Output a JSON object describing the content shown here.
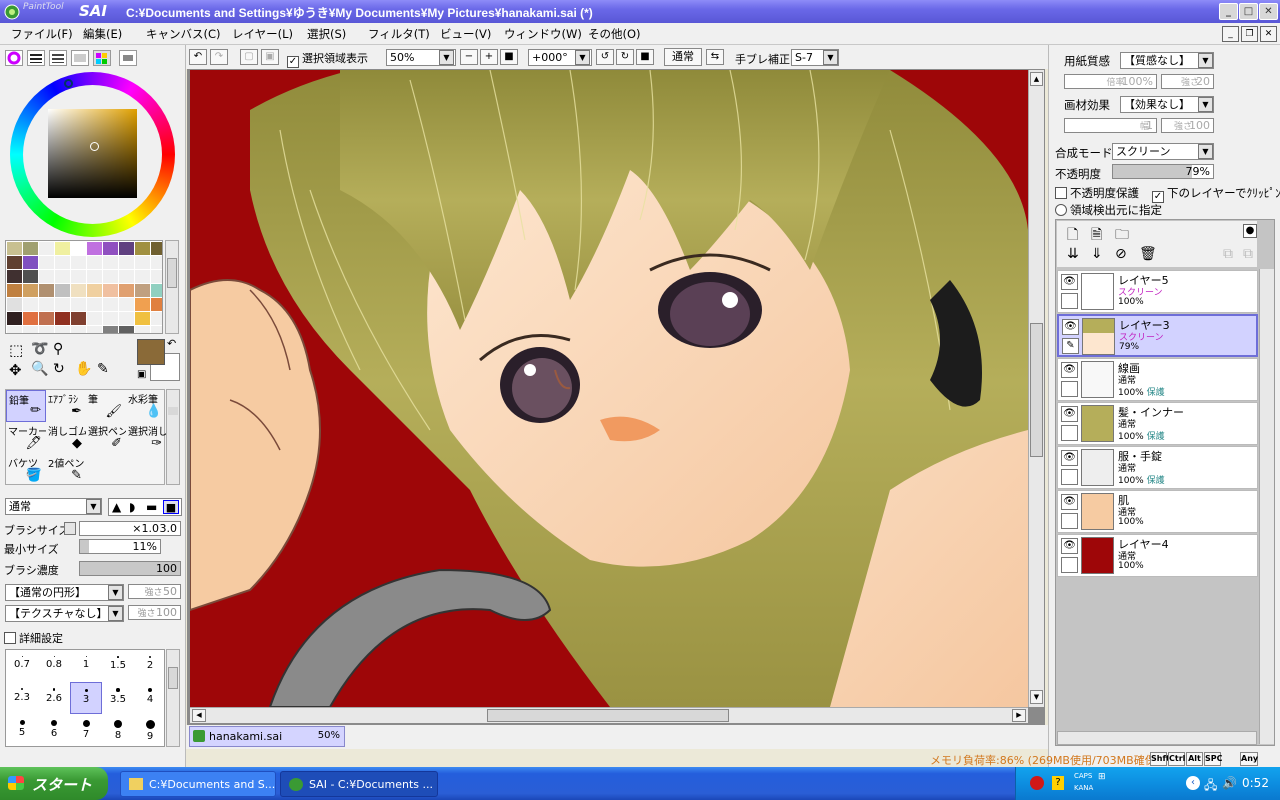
{
  "window": {
    "app_logo_top": "PaintTool",
    "app_logo_name": "SAI",
    "title": "C:¥Documents and Settings¥ゆうき¥My Documents¥My Pictures¥hanakami.sai (*)"
  },
  "menu": [
    "ファイル(F)",
    "編集(E)",
    "キャンバス(C)",
    "レイヤー(L)",
    "選択(S)",
    "フィルタ(T)",
    "ビュー(V)",
    "ウィンドウ(W)",
    "その他(O)"
  ],
  "canvas_toolbar": {
    "show_selection_label": "選択領域表示",
    "show_selection_checked": true,
    "zoom": "50%",
    "rotation": "+000°",
    "blend_button": "通常",
    "stabilizer_label": "手ブレ補正",
    "stabilizer_value": "S-7"
  },
  "left_panel": {
    "swatch_colors": [
      "#c8c090",
      "#a0a070",
      "#f0f0f0",
      "#f0f0a0",
      "#ffffff",
      "#c070e0",
      "#9050c0",
      "#604080",
      "#a09040",
      "#706030",
      "#604030",
      "#8050c0",
      "#f0f0f0",
      "#f0f0f0",
      "#f0f0f0",
      "#f0f0f0",
      "#f0f0f0",
      "#f0f0f0",
      "#f0f0f0",
      "#f0f0f0",
      "#403030",
      "#505050",
      "#f0f0f0",
      "#f0f0f0",
      "#f0f0f0",
      "#f0f0f0",
      "#f0f0f0",
      "#f0f0f0",
      "#f0f0f0",
      "#f0f0f0",
      "#c08040",
      "#d0a060",
      "#b09070",
      "#c0c0c0",
      "#f0e0c0",
      "#f0d0a0",
      "#f0c0a0",
      "#e0a070",
      "#c0a080",
      "#90d0c0",
      "#e0e0e0",
      "#f0f0f0",
      "#f0f0f0",
      "#f0f0f0",
      "#f0f0f0",
      "#f0f0f0",
      "#f0f0f0",
      "#f0f0f0",
      "#f0a050",
      "#e08040",
      "#302020",
      "#e07040",
      "#c07050",
      "#903020",
      "#804030",
      "#f0f0f0",
      "#f0f0f0",
      "#f0f0f0",
      "#f0c040",
      "#f0f0f0",
      "#f0f0f0",
      "#f0f0f0",
      "#f0f0f0",
      "#f0f0f0",
      "#f0f0f0",
      "#f0f0f0",
      "#808080",
      "#606060",
      "#f0f0f0",
      "#f0f0f0"
    ],
    "primary_color": "#8a6a38",
    "tools": [
      {
        "label": "鉛筆",
        "icon": "pencil-icon",
        "selected": true
      },
      {
        "label": "ｴｱﾌﾞﾗｼ",
        "icon": "airbrush-icon",
        "selected": false
      },
      {
        "label": "筆",
        "icon": "brush-icon",
        "selected": false
      },
      {
        "label": "水彩筆",
        "icon": "watercolor-icon",
        "selected": false
      },
      {
        "label": "マーカー",
        "icon": "marker-icon",
        "selected": false
      },
      {
        "label": "消しゴム",
        "icon": "eraser-icon",
        "selected": false
      },
      {
        "label": "選択ペン",
        "icon": "select-pen-icon",
        "selected": false
      },
      {
        "label": "選択消し",
        "icon": "select-erase-icon",
        "selected": false
      },
      {
        "label": "バケツ",
        "icon": "bucket-icon",
        "selected": false
      },
      {
        "label": "2値ペン",
        "icon": "binary-pen-icon",
        "selected": false
      }
    ],
    "blend_mode": "通常",
    "brush_size_label": "ブラシサイズ",
    "brush_size_mult": "×1.0",
    "brush_size_value": "3.0",
    "min_size_label": "最小サイズ",
    "min_size_value": "11%",
    "min_size_fraction": 0.11,
    "density_label": "ブラシ濃度",
    "density_value": "100",
    "shape": "【通常の円形】",
    "shape_strength_label": "強さ",
    "shape_strength": "50",
    "texture": "【テクスチャなし】",
    "texture_strength_label": "強さ",
    "texture_strength": "100",
    "detail_label": "詳細設定",
    "brush_sizes": [
      "0.7",
      "0.8",
      "1",
      "1.5",
      "2",
      "2.3",
      "2.6",
      "3",
      "3.5",
      "4",
      "5",
      "6",
      "7",
      "8",
      "9"
    ],
    "brush_size_selected": "3"
  },
  "doc_tab": {
    "name": "hanakami.sai",
    "zoom": "50%"
  },
  "right_panel": {
    "paper_label": "用紙質感",
    "paper_value": "【質感なし】",
    "paper_scale_label": "倍率",
    "paper_scale": "100%",
    "paper_strength_label": "強さ",
    "paper_strength": "20",
    "effect_label": "画材効果",
    "effect_value": "【効果なし】",
    "effect_width_label": "幅",
    "effect_width": "1",
    "effect_strength_label": "強さ",
    "effect_strength": "100",
    "blend_label": "合成モード",
    "blend_value": "スクリーン",
    "opacity_label": "不透明度",
    "opacity_value": "79%",
    "opacity_fraction": 0.79,
    "preserve_opacity": "不透明度保護",
    "clip_label": "下のレイヤーでｸﾘｯﾋﾟﾝｸﾞ",
    "clip_checked": true,
    "selection_source": "領域検出元に指定"
  },
  "layers": [
    {
      "name": "レイヤー5",
      "mode": "スクリーン",
      "opacity": "100%",
      "protected": "",
      "selected": false,
      "thumb": "blank"
    },
    {
      "name": "レイヤー3",
      "mode": "スクリーン",
      "opacity": "79%",
      "protected": "",
      "selected": true,
      "thumb": "face"
    },
    {
      "name": "線画",
      "mode": "通常",
      "opacity": "100%",
      "protected": "保護",
      "selected": false,
      "thumb": "lines"
    },
    {
      "name": "髪・インナー",
      "mode": "通常",
      "opacity": "100%",
      "protected": "保護",
      "selected": false,
      "thumb": "hair"
    },
    {
      "name": "服・手錠",
      "mode": "通常",
      "opacity": "100%",
      "protected": "保護",
      "selected": false,
      "thumb": "cloth"
    },
    {
      "name": "肌",
      "mode": "通常",
      "opacity": "100%",
      "protected": "",
      "selected": false,
      "thumb": "skin"
    },
    {
      "name": "レイヤー4",
      "mode": "通常",
      "opacity": "100%",
      "protected": "",
      "selected": false,
      "thumb": "red"
    }
  ],
  "status": {
    "memory": "メモリ負荷率:86% (269MB使用/703MB確保)",
    "keys": [
      "Shft",
      "Ctrl",
      "Alt",
      "SPC",
      "Any"
    ]
  },
  "taskbar": {
    "start": "スタート",
    "tasks": [
      "C:¥Documents and S...",
      "SAI - C:¥Documents ..."
    ],
    "caps": "CAPS",
    "kana": "KANA",
    "clock": "0:52"
  },
  "colors": {
    "title_bar": "#6a68e8",
    "canvas_bg": "#a0060a",
    "selected_layer": "#d2d2ff",
    "status_text": "#d2781e"
  }
}
